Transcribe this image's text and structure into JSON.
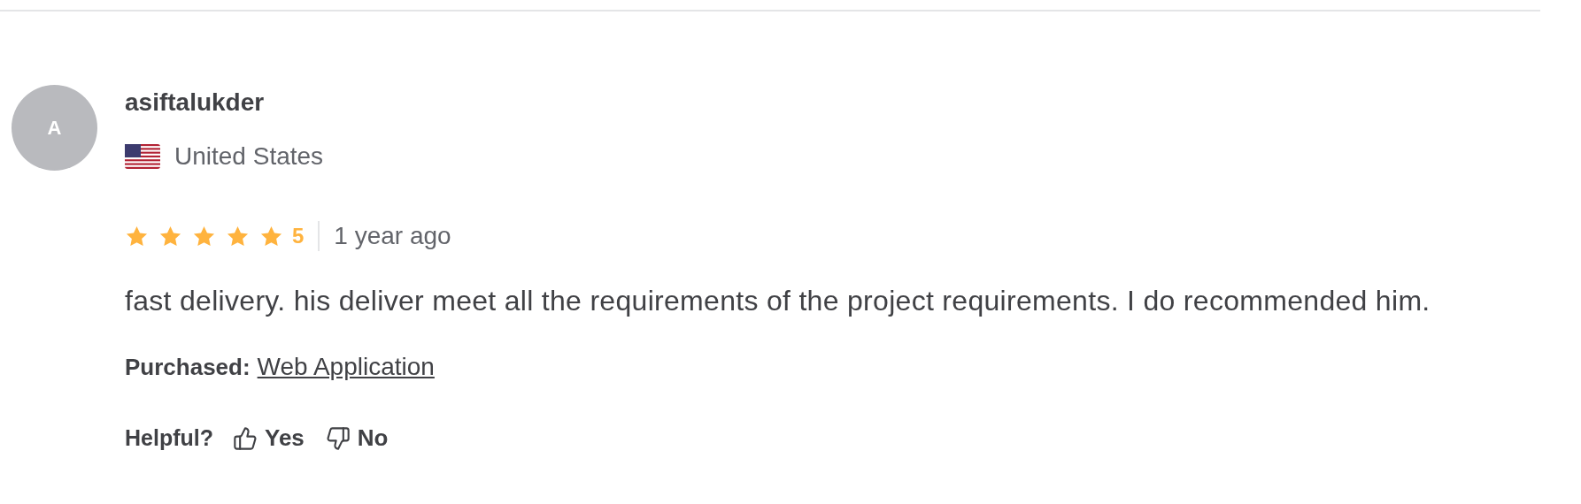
{
  "reviewer": {
    "avatar_initial": "A",
    "name": "asiftalukder",
    "country": "United States"
  },
  "rating": {
    "stars": 5,
    "score": "5",
    "time": "1 year ago"
  },
  "review_text": "fast delivery. his deliver meet all the requirements of the project requirements. I do recommended him.",
  "purchased": {
    "label": "Purchased:",
    "item": "Web Application"
  },
  "helpful": {
    "label": "Helpful?",
    "yes": "Yes",
    "no": "No"
  }
}
